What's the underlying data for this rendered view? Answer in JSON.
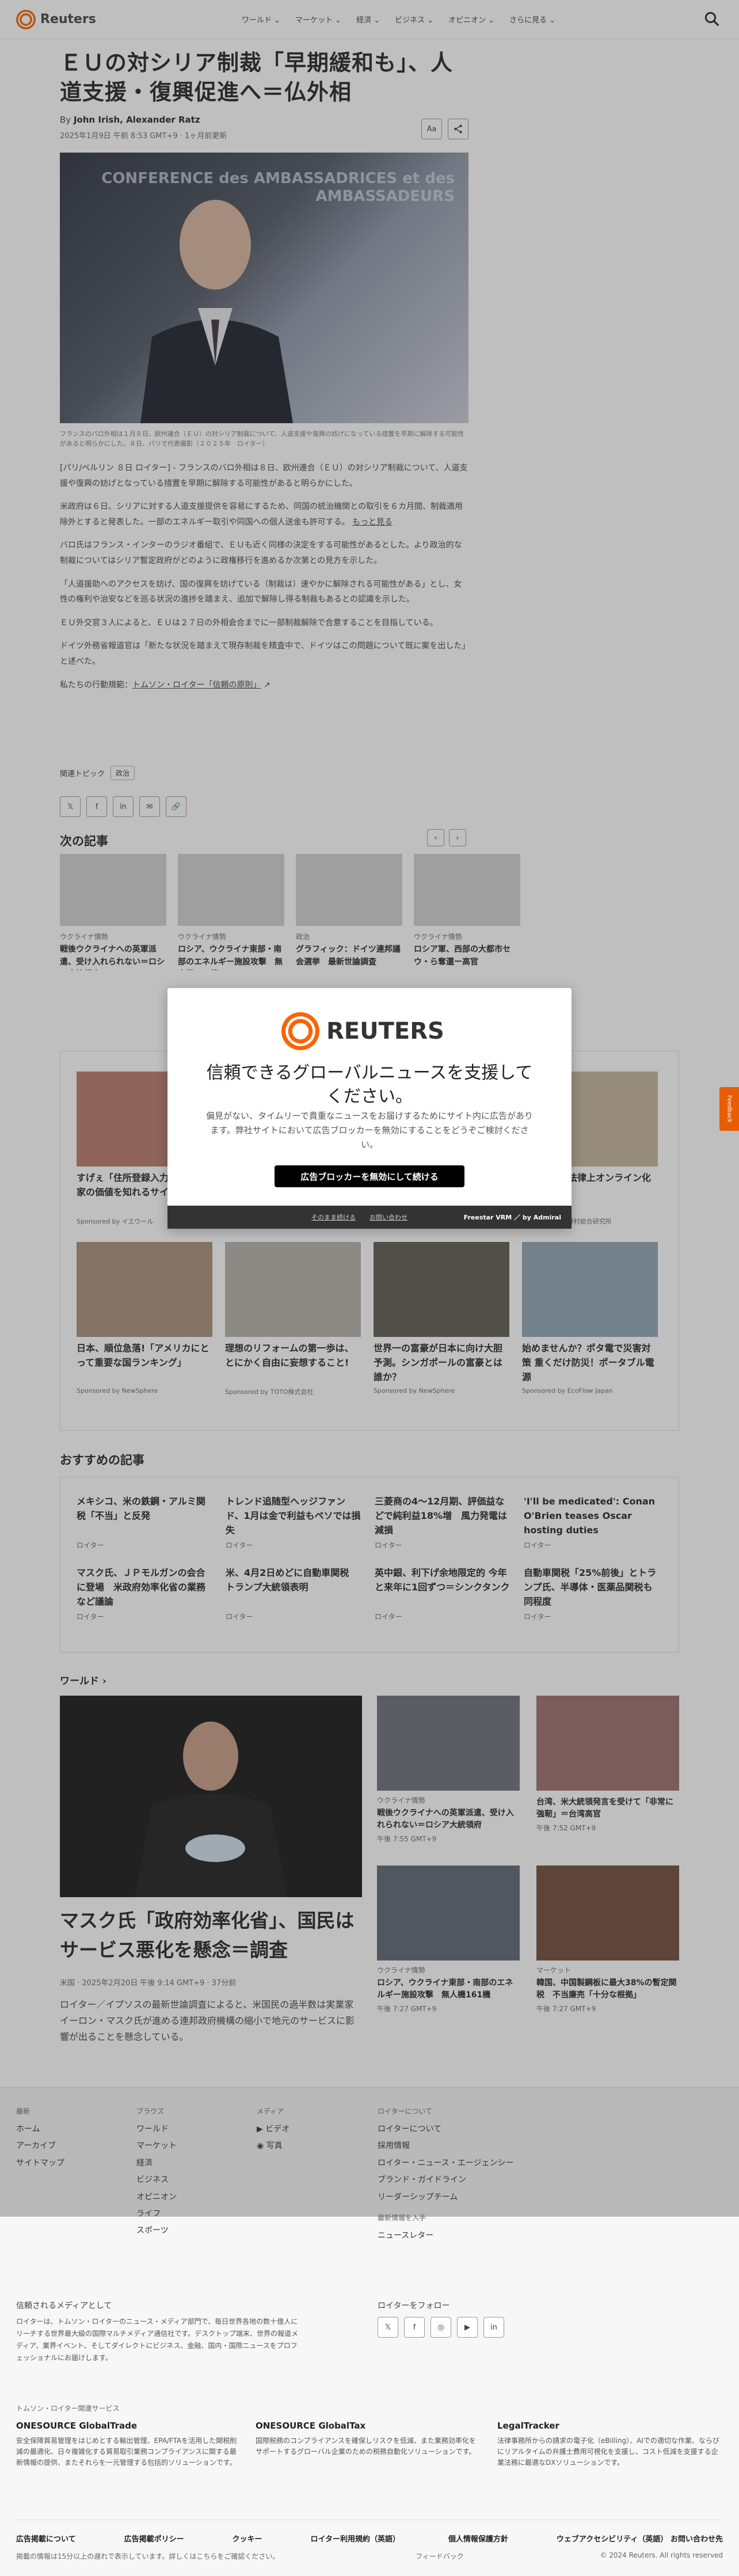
{
  "header": {
    "logo": "Reuters",
    "nav": [
      "ワールド ⌄",
      "マーケット ⌄",
      "経済 ⌄",
      "ビジネス ⌄",
      "オピニオン ⌄",
      "さらに見る ⌄"
    ]
  },
  "article": {
    "title": "ＥＵの対シリア制裁「早期緩和も」、人道支援・復興促進へ＝仏外相",
    "byline_prefix": "By",
    "authors": "John Irish, Alexander Ratz",
    "date": "2025年1月9日 午前 8:53 GMT+9 · 1ヶ月前更新",
    "font_button": "Aa",
    "hero_bg_text": "CONFERENCE des AMBASSADRICES et des AMBASSADEURS",
    "caption": "フランスのバロ外相は１月８日、欧州連合（ＥＵ）の対シリア制裁について、人道支援や復興の妨げになっている措置を早期に解除する可能性があると明らかにした。８日、パリで代表撮影（２０２５年　ロイター）",
    "paragraphs": [
      "[パリ/ベルリン ８日 ロイター] - フランスのバロ外相は８日、欧州連合（ＥＵ）の対シリア制裁について、人道支援や復興の妨げとなっている措置を早期に解除する可能性があると明らかにした。",
      "米政府は６日、シリアに対する人道支援提供を容易にするため、同国の統治機関との取引を６カ月間、制裁適用除外とすると発表した。一部のエネルギー取引や同国への個人送金も許可する。",
      "バロ氏はフランス・インターのラジオ番組で、ＥＵも近く同様の決定をする可能性があるとした。より政治的な制裁についてはシリア暫定政府がどのように政権移行を進めるか次第との見方を示した。",
      "「人道援助へのアクセスを妨げ、国の復興を妨げている（制裁は）速やかに解除される可能性がある」とし、女性の権利や治安などを巡る状況の進捗を踏まえ、追加で解除し得る制裁もあるとの認識を示した。",
      "ＥＵ外交官３人によると、ＥＵは２７日の外相会合までに一部制裁解除で合意することを目指している。",
      "ドイツ外務省報道官は「新たな状況を踏まえて現存制裁を精査中で、ドイツはこの問題について既に案を出した」と述べた。"
    ],
    "more_link": "もっと見る",
    "principles_prefix": "私たちの行動規範：",
    "principles_link": "トムソン・ロイター「信頼の原則」",
    "topics_label": "関連トピック",
    "topic": "政治"
  },
  "next_articles": {
    "heading": "次の記事",
    "items": [
      {
        "kicker": "ウクライナ情勢",
        "title": "戦後ウクライナへの英軍派遣、受け入れられない＝ロシア大統領府"
      },
      {
        "kicker": "ウクライナ情勢",
        "title": "ロシア、ウクライナ東部・南部のエネルギー施設攻撃　無人機161機"
      },
      {
        "kicker": "政治",
        "title": "グラフィック：ドイツ連邦議会選挙　最新世論調査"
      },
      {
        "kicker": "ウクライナ情勢",
        "title": "ロシア軍、西部の大都市セウ・ら奪還ー高官"
      }
    ]
  },
  "sponsored": {
    "items": [
      {
        "title": "すげぇ「住所登録入力してOK」家の価値を知れるサイト",
        "by": "Sponsored by イエウール"
      },
      {
        "title": "",
        "by": ""
      },
      {
        "title": "",
        "by": ""
      },
      {
        "title": "営業契約が法律上オンライン化可能",
        "by": "Sponsored by 野村総合研究所"
      },
      {
        "title": "日本、順位急落!「アメリカにとって重要な国ランキング」",
        "by": "Sponsored by NewSphere"
      },
      {
        "title": "理想のリフォームの第一歩は、とにかく自由に妄想すること!",
        "by": "Sponsored by TOTO株式会社"
      },
      {
        "title": "世界一の富豪が日本に向け大胆予測。シンガポールの富豪とは誰か？",
        "by": "Sponsored by NewSphere"
      },
      {
        "title": "始めませんか？ポタ電で災害対策 重くだけ防災！ポータブル電源",
        "by": "Sponsored by EcoFlow Japan"
      }
    ]
  },
  "recommended": {
    "heading": "おすすめの記事",
    "items": [
      {
        "title": "メキシコ、米の鉄鋼・アルミ関税「不当」と反発",
        "source": "ロイター"
      },
      {
        "title": "トレンド追随型ヘッジファンド、1月は金で利益もペソでは損失",
        "source": "ロイター"
      },
      {
        "title": "三菱商の4～12月期、評価益などで純利益18%増　風力発電は減損",
        "source": "ロイター"
      },
      {
        "title": "'I'll be medicated': Conan O'Brien teases Oscar hosting duties",
        "source": "ロイター"
      },
      {
        "title": "マスク氏、ＪＰモルガンの会合に登場　米政府効率化省の業務など議論",
        "source": "ロイター"
      },
      {
        "title": "米、4月2日めどに自動車関税 トランプ大統領表明",
        "source": "ロイター"
      },
      {
        "title": "英中銀、利下げ余地限定的 今年と来年に1回ずつ＝シンクタンク",
        "source": "ロイター"
      },
      {
        "title": "自動車関税「25%前後」とトランプ氏、半導体・医薬品関税も同程度",
        "source": "ロイター"
      }
    ]
  },
  "world": {
    "heading": "ワールド ›",
    "main_title": "マスク氏「政府効率化省」、国民はサービス悪化を懸念＝調査",
    "main_meta": "米国 · 2025年2月20日 午後 9:14 GMT+9 · 37分前",
    "main_desc": "ロイター／イプソスの最新世論調査によると、米国民の過半数は実業家イーロン・マスク氏が進める連邦政府機構の縮小で地元のサービスに影響が出ることを懸念している。",
    "side": [
      {
        "kicker": "ウクライナ情勢",
        "title": "戦後ウクライナへの英軍派遣、受け入れられない＝ロシア大統領府",
        "time": "午後 7:55 GMT+9"
      },
      {
        "kicker": "",
        "title": "台湾、米大統領発言を受けて「非常に強靭」＝台湾高官",
        "time": "午後 7:52 GMT+9"
      },
      {
        "kicker": "ウクライナ情勢",
        "title": "ロシア、ウクライナ東部・南部のエネルギー施設攻撃　無人機161機",
        "time": "午後 7:27 GMT+9"
      },
      {
        "kicker": "マーケット",
        "title": "韓国、中国製鋼板に最大38%の暫定関税　不当廉売「十分な根拠」",
        "time": "午後 7:27 GMT+9"
      }
    ]
  },
  "footer": {
    "col1": [
      "最新",
      "ホーム",
      "アーカイブ",
      "サイトマップ"
    ],
    "col2_head": "ブラウズ",
    "col2": [
      "ワールド",
      "マーケット",
      "経済",
      "ビジネス",
      "オピニオン",
      "ライフ",
      "スポーツ"
    ],
    "col3_head": "メディア",
    "col3": [
      "ビデオ",
      "写真"
    ],
    "col4_head": "ロイターについて",
    "col4": [
      "ロイターについて",
      "採用情報",
      "ロイター・ニュース・エージェンシー",
      "ブランド・ガイドライン",
      "リーダーシップチーム"
    ],
    "news_head": "最新情報を入手",
    "newsletter": "ニュースレター",
    "about_head": "信頼されるメディアとして",
    "about_text": "ロイターは、トムソン・ロイターのニュース・メディア部門で、毎日世界各地の数十億人にリーチする世界最大級の国際マルチメディア通信社です。デスクトップ端末、世界の報道メディア、業界イベント、そしてダイレクトにビジネス、金融、国内・国際ニュースをプロフェッショナルにお届けします。",
    "follow_head": "ロイターをフォロー",
    "related_head": "トムソン・ロイター関連サービス",
    "products": [
      {
        "name": "ONESOURCE GlobalTrade",
        "desc": "安全保障貿易管理をはじめとする輸出管理、EPA/FTAを活用した関税削減の最適化、日々複雑化する貿易取引業務コンプライアンスに関する最新情報の提供、またそれらを一元管理する包括的ソリューションです。"
      },
      {
        "name": "ONESOURCE GlobalTax",
        "desc": "国際税務のコンプライアンスを確保しリスクを低減、また業務効率化をサポートするグローバル企業のための税務自動化ソリューションです。"
      },
      {
        "name": "LegalTracker",
        "desc": "法律事務所からの請求の電子化（eBilling）、AIでの適切な作業、ならびにリアルタイムの弁護士費用可視化を支援し、コスト低減を支援する企業法務に最適なDXソリューションです。"
      }
    ],
    "links": [
      "広告掲載について",
      "広告掲載ポリシー",
      "クッキー",
      "ロイター利用規約（英語）",
      "個人情報保護方針",
      "ウェブアクセシビリティ（英語） お問い合わせ先"
    ],
    "feedback_link": "フィードバック",
    "delay_note": "掲載の情報は15分以上の遅れで表示しています。詳しくはこちらをご確認ください。",
    "copyright": "© 2024 Reuters. All rights reserved"
  },
  "modal": {
    "logo": "REUTERS",
    "title": "信頼できるグローバルニュースを支援してください。",
    "body": "偏見がない、タイムリーで貴重なニュースをお届けするためにサイト内に広告があります。弊社サイトにおいて広告ブロッカーを無効にすることをどうぞご検討ください。",
    "button": "広告ブロッカーを無効にして続ける",
    "link1": "そのまま続ける",
    "link2": "お問い合わせ",
    "brand": "Freestar VRM ／ by Admiral"
  },
  "feedback_tab": "Feedback"
}
